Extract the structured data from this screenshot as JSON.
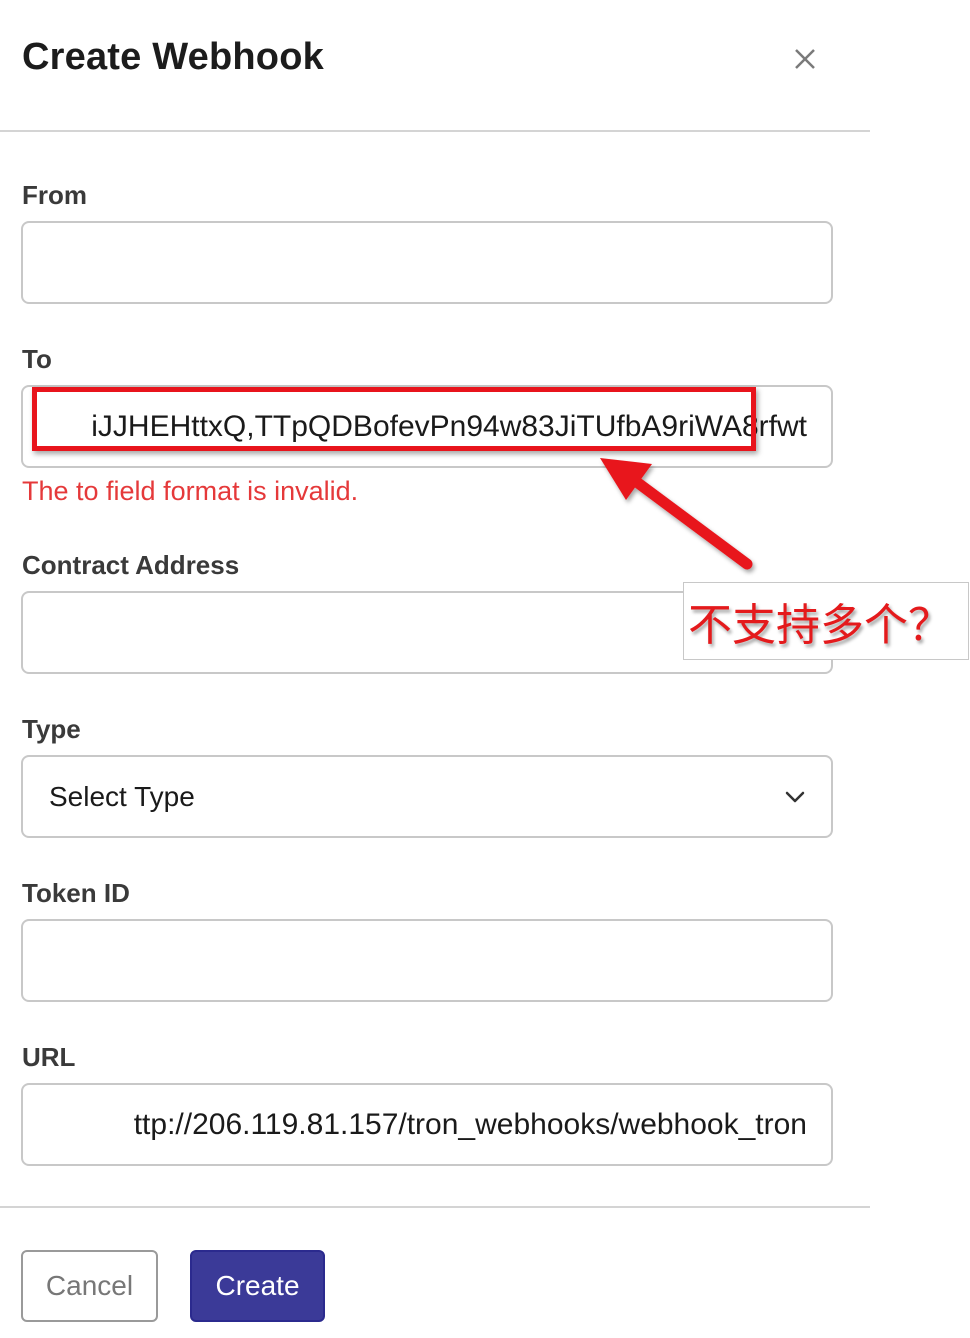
{
  "dialog": {
    "title": "Create Webhook",
    "close_icon": "close-icon"
  },
  "fields": {
    "from": {
      "label": "From",
      "value": ""
    },
    "to": {
      "label": "To",
      "value": "iJJHEHttxQ,TTpQDBofevPn94w83JiTUfbA9riWA8rfwt",
      "error": "The to field format is invalid."
    },
    "contract_address": {
      "label": "Contract Address",
      "value": ""
    },
    "type": {
      "label": "Type",
      "selected": "Select Type",
      "icon": "chevron-down-icon"
    },
    "token_id": {
      "label": "Token ID",
      "value": ""
    },
    "url": {
      "label": "URL",
      "value": "ttp://206.119.81.157/tron_webhooks/webhook_tron"
    }
  },
  "actions": {
    "cancel_label": "Cancel",
    "create_label": "Create"
  },
  "annotation": {
    "text": "不支持多个？",
    "color": "#e41a1c"
  },
  "colors": {
    "error": "#e5393a",
    "primary_button": "#3b3a98"
  }
}
